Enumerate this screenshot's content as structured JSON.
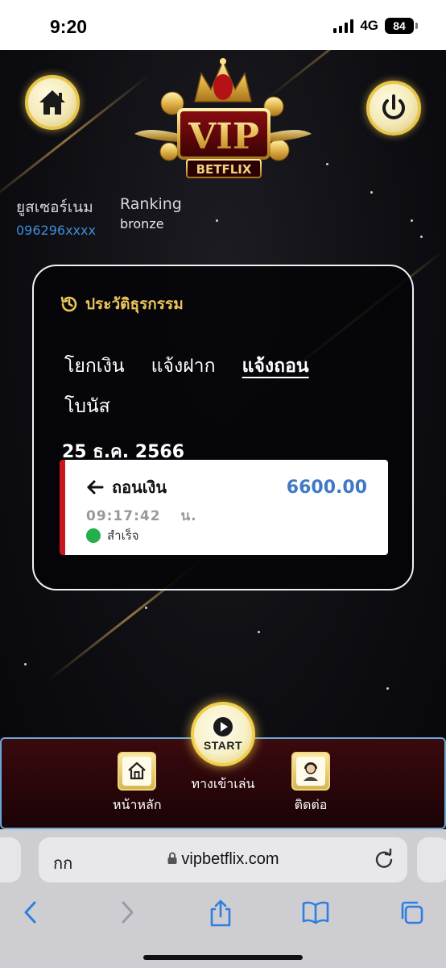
{
  "status_bar": {
    "time": "9:20",
    "network": "4G",
    "battery": "84"
  },
  "header": {
    "logo_text": "VIP",
    "logo_subtext": "BETFLIX",
    "home_button": "home-icon",
    "power_button": "power-icon"
  },
  "user": {
    "username_label": "ยูสเซอร์เนม",
    "username": "096296xxxx",
    "ranking_label": "Ranking",
    "ranking": "bronze"
  },
  "history": {
    "title": "ประวัติธุรกรรม",
    "tabs": [
      {
        "label": "โยกเงิน",
        "active": false
      },
      {
        "label": "แจ้งฝาก",
        "active": false
      },
      {
        "label": "แจ้งถอน",
        "active": true
      },
      {
        "label": "โบนัส",
        "active": false
      }
    ],
    "date": "25 ธ.ค. 2566",
    "transaction": {
      "type": "ถอนเงิน",
      "amount": "6600.00",
      "time": "09:17:42",
      "time_unit": "น.",
      "status": "สำเร็จ",
      "status_color": "#22b04a"
    }
  },
  "bottom_nav": {
    "home": "หน้าหลัก",
    "start_label": "START",
    "start_caption": "ทางเข้าเล่น",
    "contact": "ติดต่อ"
  },
  "browser": {
    "aa": "กก",
    "url": "vipbetflix.com"
  },
  "colors": {
    "accent_gold": "#ecc659",
    "amount_blue": "#3e78c7",
    "tx_border_red": "#c9171e"
  }
}
